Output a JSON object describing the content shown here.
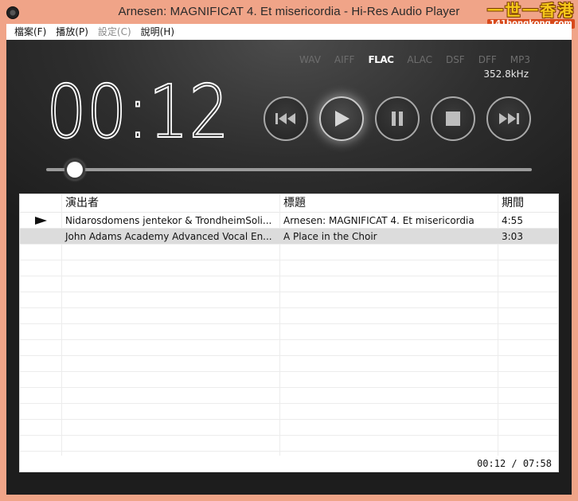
{
  "window": {
    "title": "Arnesen: MAGNIFICAT 4. Et misericordia - Hi-Res Audio Player",
    "watermark_top": "一世一香港",
    "watermark_bottom": "141hongkong.com"
  },
  "menu": [
    {
      "label": "檔案(F)",
      "enabled": true
    },
    {
      "label": "播放(P)",
      "enabled": true
    },
    {
      "label": "設定(C)",
      "enabled": false
    },
    {
      "label": "說明(H)",
      "enabled": true
    }
  ],
  "player": {
    "formats": [
      "WAV",
      "AIFF",
      "FLAC",
      "ALAC",
      "DSF",
      "DFF",
      "MP3"
    ],
    "active_format": "FLAC",
    "sample_rate": "352.8kHz",
    "elapsed": "00:12",
    "progress": 0.026
  },
  "playlist": {
    "columns": [
      "",
      "演出者",
      "標題",
      "期間"
    ],
    "rows": [
      {
        "playing": true,
        "artist": "Nidarosdomens jentekor & TrondheimSoli...",
        "title": "Arnesen: MAGNIFICAT 4. Et misericordia",
        "duration": "4:55"
      },
      {
        "playing": false,
        "artist": "John Adams Academy Advanced Vocal En...",
        "title": "A Place in the Choir",
        "duration": "3:03"
      }
    ],
    "total_time": "00:12 / 07:58"
  },
  "icons": {
    "prev": "skip-back-icon",
    "play": "play-icon",
    "pause": "pause-icon",
    "stop": "stop-icon",
    "next": "skip-forward-icon"
  }
}
